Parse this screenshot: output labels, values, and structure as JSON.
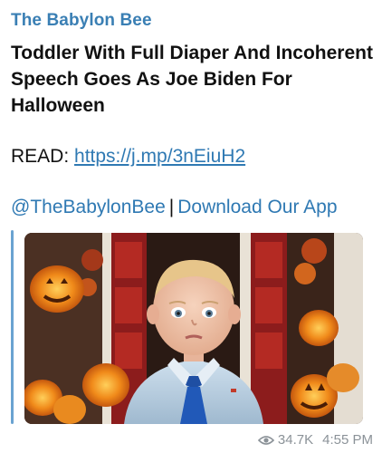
{
  "post": {
    "channel": "The Babylon Bee",
    "headline": "Toddler With Full Diaper And Incoherent Speech Goes As Joe Biden For Halloween",
    "read_label": "READ:",
    "read_link": "https://j.mp/3nEiuH2",
    "handle_link": "@TheBabylonBee",
    "separator": "|",
    "app_link": "Download Our App"
  },
  "preview": {
    "icon": "toddler-halloween-photo"
  },
  "meta": {
    "views": "34.7K",
    "time": "4:55 PM",
    "icon": "eye-icon"
  }
}
